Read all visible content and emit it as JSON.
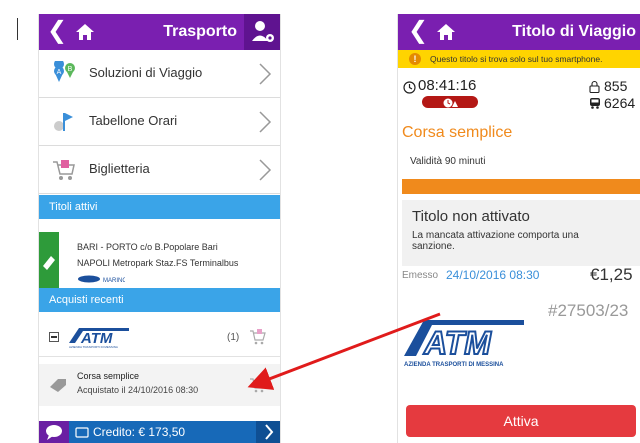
{
  "colors": {
    "purple": "#7a1fb0",
    "blue": "#3aa4e8",
    "orange": "#f08a1c",
    "green": "#2e9b3a",
    "red": "#e53a3f",
    "yellow": "#ffd400"
  },
  "left": {
    "header": {
      "title": "Trasporto",
      "back_icon": "chevron-left-icon",
      "home_icon": "home-icon",
      "user_icon": "user-settings-icon"
    },
    "menu": [
      {
        "label": "Soluzioni di Viaggio",
        "icon": "map-pin-ab-icon"
      },
      {
        "label": "Tabellone Orari",
        "icon": "departure-board-icon"
      },
      {
        "label": "Biglietteria",
        "icon": "shopping-cart-icon"
      }
    ],
    "active_section": "Titoli attivi",
    "active_ticket": {
      "line1": "BARI - PORTO c/o B.Popolare Bari",
      "line2": "NAPOLI Metropark Staz.FS Terminalbus",
      "logo": "MARINO"
    },
    "recent_section": "Acquisti recenti",
    "recent_group": {
      "count": "(1)",
      "logo": "ATM",
      "logo_sub": "AZIENDA TRASPORTI DI MESSINA"
    },
    "recent_item": {
      "name": "Corsa semplice",
      "date": "Acquistato il 24/10/2016 08:30"
    },
    "footer": {
      "credit": "Credito: € 173,50"
    }
  },
  "right": {
    "header": {
      "title": "Titolo di Viaggio",
      "back_icon": "chevron-left-icon",
      "home_icon": "home-icon"
    },
    "warning": "Questo titolo si trova solo sul tuo smartphone.",
    "time": "08:41:16",
    "num1": "855",
    "num2": "6264",
    "fare": "Corsa semplice",
    "validity": "Validità 90 minuti",
    "status_title": "Titolo non attivato",
    "status_desc": "La mancata attivazione comporta una sanzione.",
    "issued_label": "Emesso",
    "issued_date": "24/10/2016 08:30",
    "price": "€1,25",
    "ticket_number": "#27503/23",
    "atm_sub": "AZIENDA TRASPORTI DI MESSINA",
    "activate": "Attiva"
  }
}
